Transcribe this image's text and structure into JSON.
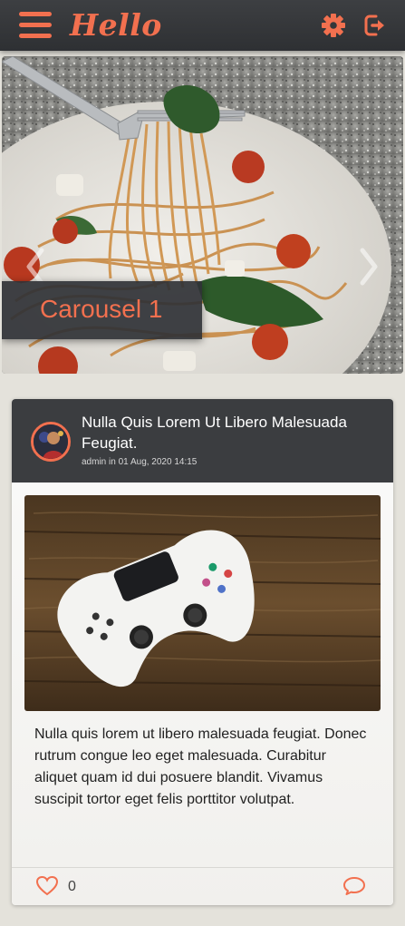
{
  "header": {
    "app_title": "Hello",
    "menu_icon": "hamburger-menu-icon",
    "settings_icon": "gear-icon",
    "logout_icon": "logout-icon",
    "accent_color": "#f2704f",
    "bar_color": "#3b3d40"
  },
  "carousel": {
    "caption": "Carousel 1",
    "prev_icon": "chevron-left-icon",
    "next_icon": "chevron-right-icon"
  },
  "post": {
    "title": "Nulla Quis Lorem Ut Libero Malesuada Feugiat.",
    "author": "admin",
    "date_prefix": "in",
    "date": "01 Aug, 2020 14:15",
    "body": "Nulla quis lorem ut libero malesuada feugiat. Donec rutrum congue leo eget malesuada. Curabitur aliquet quam id dui posuere blandit. Vivamus suscipit tortor eget felis porttitor volutpat.",
    "likes": "0",
    "like_icon": "heart-icon",
    "comment_icon": "comment-bubble-icon"
  }
}
